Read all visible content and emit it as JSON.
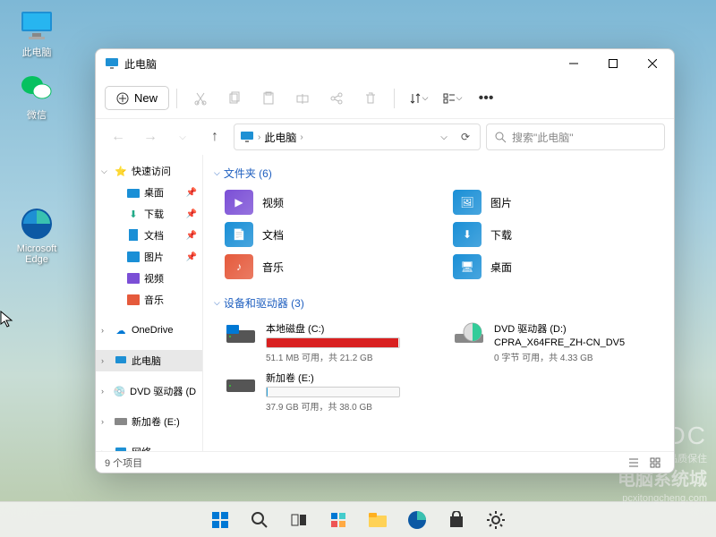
{
  "desktop": {
    "icons": [
      {
        "name": "this-pc",
        "label": "此电脑"
      },
      {
        "name": "wechat",
        "label": "微信"
      },
      {
        "name": "edge",
        "label": "Microsoft Edge"
      }
    ]
  },
  "watermark": {
    "idc": "IDC",
    "tagline": "至真至诚 品质保住",
    "brand": "电脑系统城",
    "url": "pcxitongcheng.com"
  },
  "window": {
    "title": "此电脑",
    "new_label": "New",
    "breadcrumb": "此电脑",
    "search_placeholder": "搜索\"此电脑\"",
    "sidebar": {
      "quick_access": "快速访问",
      "items": [
        {
          "label": "桌面"
        },
        {
          "label": "下载"
        },
        {
          "label": "文档"
        },
        {
          "label": "图片"
        },
        {
          "label": "视频"
        },
        {
          "label": "音乐"
        }
      ],
      "onedrive": "OneDrive",
      "this_pc": "此电脑",
      "dvd": "DVD 驱动器 (D:)",
      "volume_e": "新加卷 (E:)",
      "network": "网络"
    },
    "sections": {
      "folders_label": "文件夹 (6)",
      "devices_label": "设备和驱动器 (3)"
    },
    "folders": [
      {
        "label": "视频",
        "color": "#7b4fd6"
      },
      {
        "label": "图片",
        "color": "#1a8fd6"
      },
      {
        "label": "文档",
        "color": "#1a8fd6"
      },
      {
        "label": "下载",
        "color": "#1a8fd6"
      },
      {
        "label": "音乐",
        "color": "#e55a3c"
      },
      {
        "label": "桌面",
        "color": "#1a8fd6"
      }
    ],
    "drives": [
      {
        "name": "本地磁盘 (C:)",
        "sub": "51.1 MB 可用，共 21.2 GB",
        "fill_pct": 99,
        "fill_color": "#d92020"
      },
      {
        "name": "DVD 驱动器 (D:)",
        "sub2": "CPRA_X64FRE_ZH-CN_DV5",
        "sub": "0 字节 可用，共 4.33 GB"
      },
      {
        "name": "新加卷 (E:)",
        "sub": "37.9 GB 可用，共 38.0 GB",
        "fill_pct": 1,
        "fill_color": "#26a0da"
      }
    ],
    "status": "9 个项目"
  }
}
